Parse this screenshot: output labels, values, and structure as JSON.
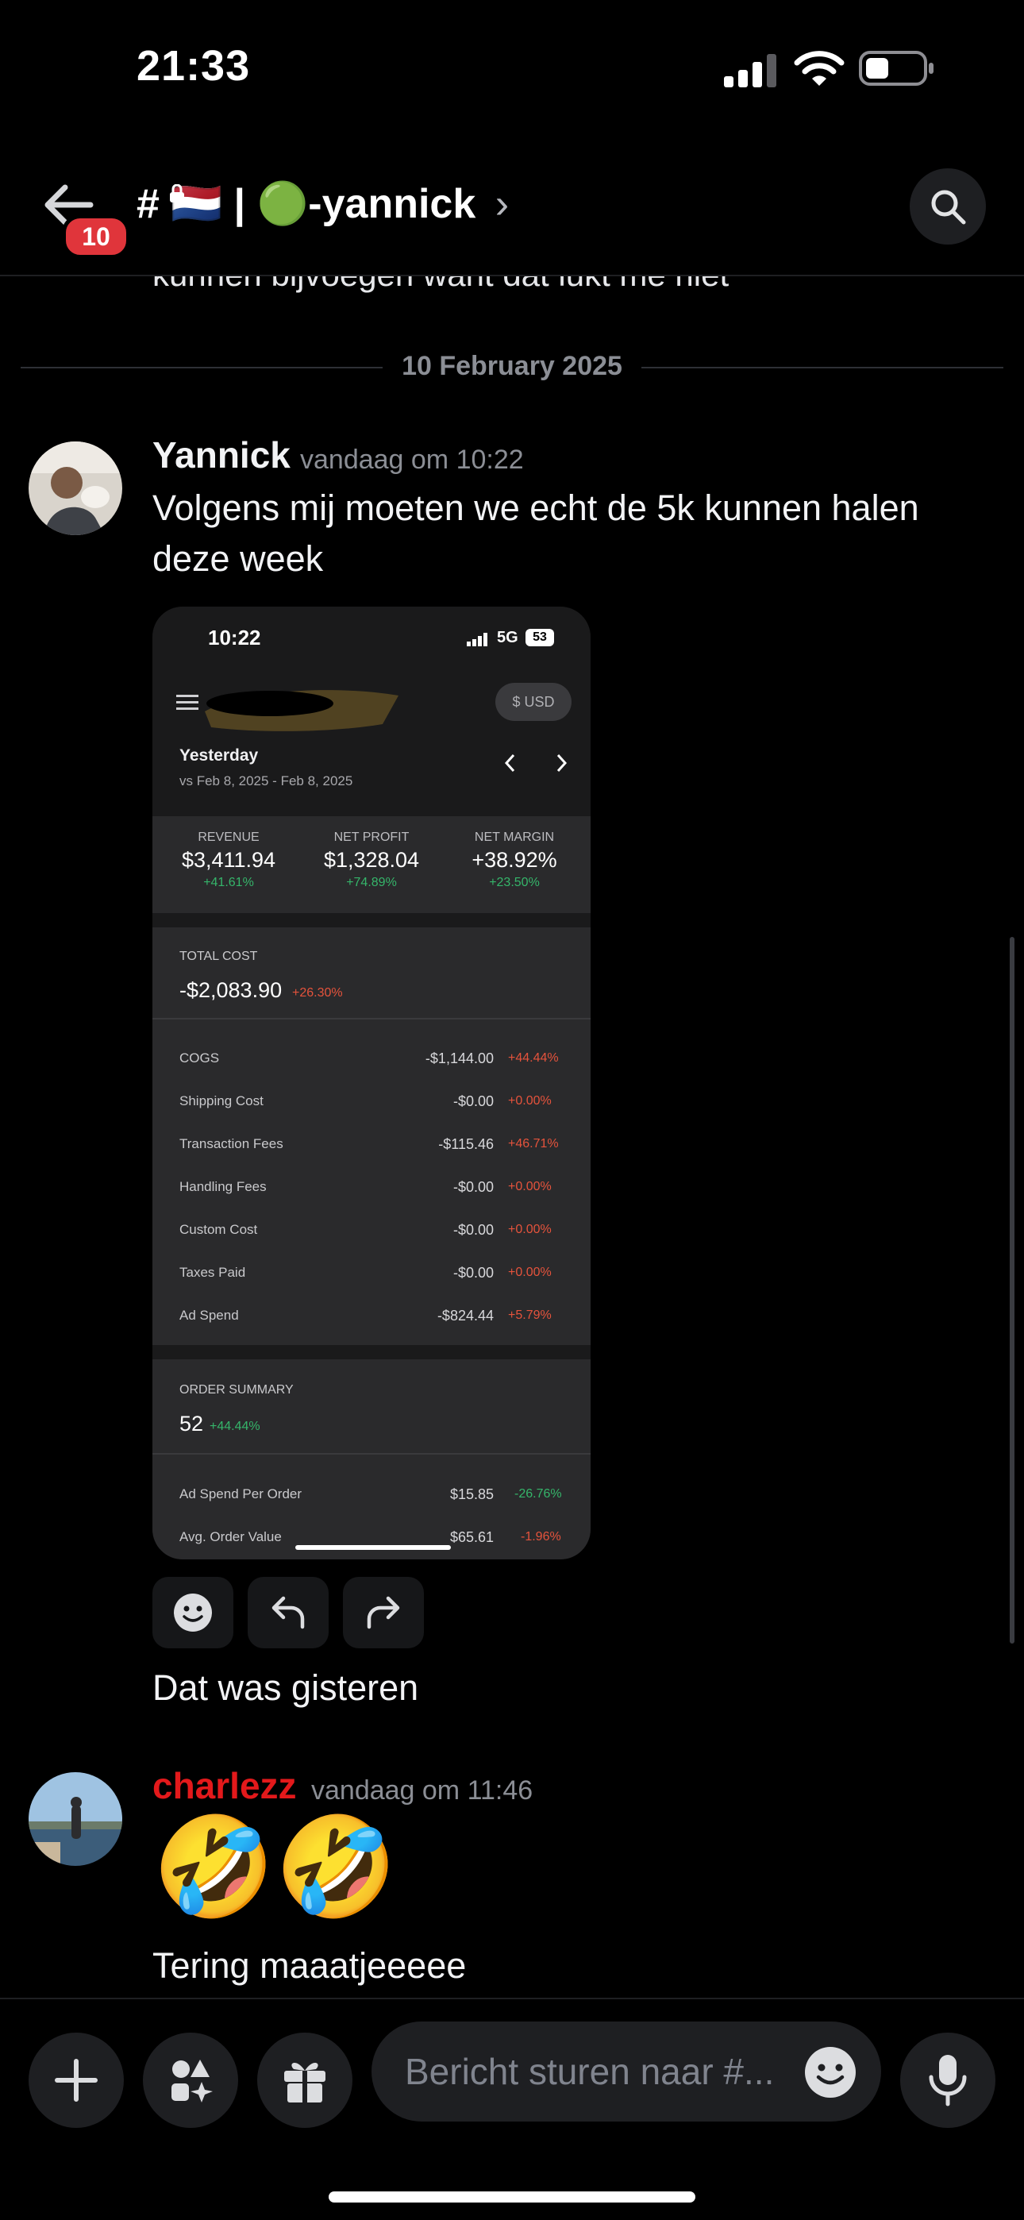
{
  "status_bar": {
    "time": "21:33"
  },
  "header": {
    "back_badge": "10",
    "channel_title": "# 🇳🇱 | 🟢-yannick",
    "chevron": "›"
  },
  "clipped_previous_text": "kunnen bijvoegen want dat lukt me niet",
  "date_divider": "10 February 2025",
  "messages": [
    {
      "author": "Yannick",
      "author_color": "#f2f3f5",
      "timestamp": "vandaag om 10:22",
      "text": "Volgens mij moeten we echt de 5k kunnen halen deze week",
      "followup": "Dat was gisteren"
    },
    {
      "author": "charlezz",
      "author_color": "#e3191b",
      "timestamp": "vandaag om 11:46",
      "emoji": "🤣🤣",
      "text": "Tering maaatjeeeee"
    }
  ],
  "embedded_screenshot": {
    "time": "10:22",
    "network": "5G",
    "battery": "53",
    "currency_button": "$ USD",
    "period": "Yesterday",
    "comparison": "vs Feb 8, 2025 - Feb 8, 2025",
    "kpis": [
      {
        "label": "REVENUE",
        "value": "$3,411.94",
        "change": "+41.61%"
      },
      {
        "label": "NET PROFIT",
        "value": "$1,328.04",
        "change": "+74.89%"
      },
      {
        "label": "NET MARGIN",
        "value": "+38.92%",
        "change": "+23.50%"
      }
    ],
    "total_cost": {
      "label": "TOTAL COST",
      "value": "-$2,083.90",
      "change": "+26.30%"
    },
    "cost_rows": [
      {
        "label": "COGS",
        "value": "-$1,144.00",
        "change": "+44.44%"
      },
      {
        "label": "Shipping Cost",
        "value": "-$0.00",
        "change": "+0.00%"
      },
      {
        "label": "Transaction Fees",
        "value": "-$115.46",
        "change": "+46.71%"
      },
      {
        "label": "Handling Fees",
        "value": "-$0.00",
        "change": "+0.00%"
      },
      {
        "label": "Custom Cost",
        "value": "-$0.00",
        "change": "+0.00%"
      },
      {
        "label": "Taxes Paid",
        "value": "-$0.00",
        "change": "+0.00%"
      },
      {
        "label": "Ad Spend",
        "value": "-$824.44",
        "change": "+5.79%"
      }
    ],
    "order_summary": {
      "label": "ORDER SUMMARY",
      "value": "52",
      "change": "+44.44%"
    },
    "order_rows": [
      {
        "label": "Ad Spend Per Order",
        "value": "$15.85",
        "change": "-26.76%"
      },
      {
        "label": "Avg. Order Value",
        "value": "$65.61",
        "change": "-1.96%"
      }
    ]
  },
  "composer": {
    "placeholder": "Bericht sturen naar #..."
  },
  "icons": {
    "back": "arrow-left-icon",
    "search": "search-icon",
    "plus": "plus-icon",
    "apps": "apps-icon",
    "gift": "gift-icon",
    "emoji": "emoji-icon",
    "mic": "microphone-icon",
    "reply": "reply-icon",
    "forward": "forward-icon"
  }
}
